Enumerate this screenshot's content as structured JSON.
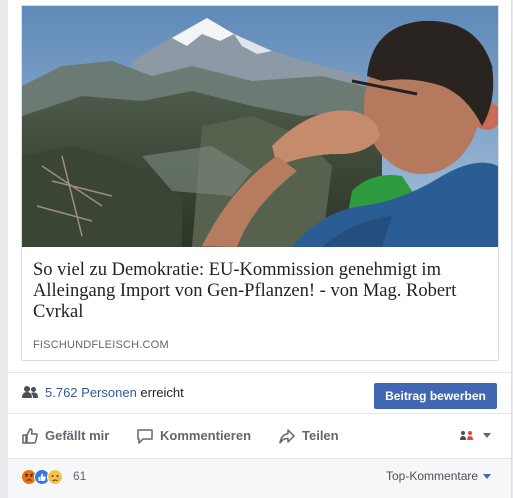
{
  "link_preview": {
    "headline": "So viel zu Demokratie: EU-Kommission genehmigt im Alleingang Import von Gen-Pflanzen! - von Mag. Robert Cvrkal",
    "domain": "FISCHUNDFLEISCH.COM"
  },
  "reach": {
    "count_text": "5.762 Personen",
    "suffix": " erreicht",
    "boost_label": "Beitrag bewerben"
  },
  "actions": {
    "like": "Gefällt mir",
    "comment": "Kommentieren",
    "share": "Teilen"
  },
  "footer": {
    "reaction_count": "61",
    "sort_label": "Top-Kommentare"
  },
  "icons": {
    "reach": "people-icon",
    "like": "thumbs-up-icon",
    "comment": "speech-bubble-icon",
    "share": "share-arrow-icon",
    "audience": "friends-icon",
    "reactions": [
      "angry-reaction-icon",
      "like-reaction-icon",
      "sad-reaction-icon"
    ]
  },
  "colors": {
    "brand": "#4267b2",
    "link": "#365899",
    "muted": "#606770"
  }
}
